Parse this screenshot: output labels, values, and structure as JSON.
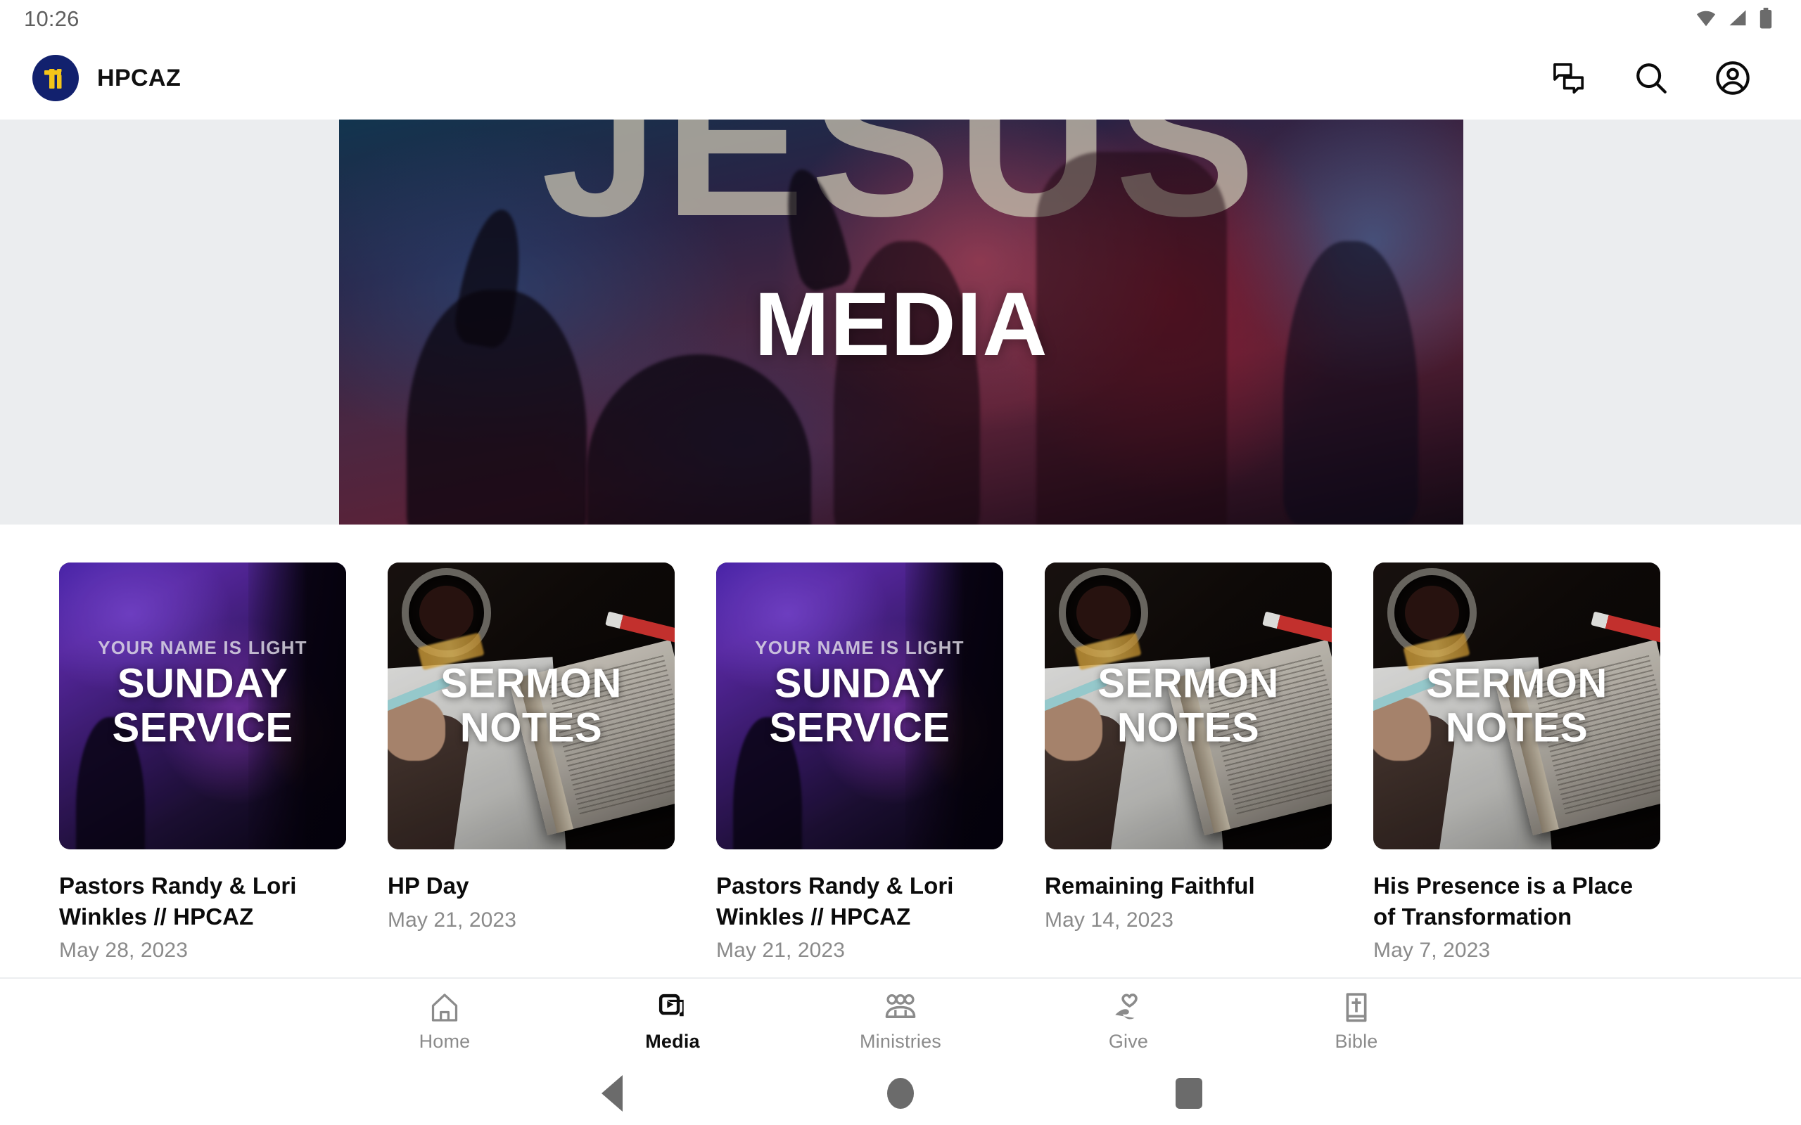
{
  "status_bar": {
    "time": "10:26",
    "icons": [
      "wifi-icon",
      "cellular-signal-icon",
      "battery-icon"
    ]
  },
  "app_bar": {
    "brand_name": "HPCAZ",
    "logo": "hpcaz-logo-icon",
    "actions": [
      {
        "name": "messages-icon",
        "label": "Messages"
      },
      {
        "name": "search-icon",
        "label": "Search"
      },
      {
        "name": "account-icon",
        "label": "Account"
      }
    ]
  },
  "hero": {
    "background_text": "JESUS",
    "title": "MEDIA",
    "side_background_color": "#ebedef"
  },
  "media_items": [
    {
      "art_style": "sunday",
      "kicker": "YOUR NAME IS LIGHT",
      "thumb_caption": "SUNDAY\nSERVICE",
      "title": "Pastors Randy & Lori Winkles // HPCAZ",
      "date": "May 28, 2023"
    },
    {
      "art_style": "notes",
      "kicker": "",
      "thumb_caption": "SERMON\nNOTES",
      "title": "HP Day",
      "date": "May 21, 2023"
    },
    {
      "art_style": "sunday",
      "kicker": "YOUR NAME IS LIGHT",
      "thumb_caption": "SUNDAY\nSERVICE",
      "title": "Pastors Randy & Lori Winkles // HPCAZ",
      "date": "May 21, 2023"
    },
    {
      "art_style": "notes",
      "kicker": "",
      "thumb_caption": "SERMON\nNOTES",
      "title": "Remaining Faithful",
      "date": "May 14, 2023"
    },
    {
      "art_style": "notes",
      "kicker": "",
      "thumb_caption": "SERMON\nNOTES",
      "title": "His Presence is a Place of Transformation",
      "date": "May 7, 2023"
    }
  ],
  "tab_bar": {
    "active": "Media",
    "tabs": [
      {
        "label": "Home",
        "icon": "home-icon",
        "active": false
      },
      {
        "label": "Media",
        "icon": "media-library-icon",
        "active": true
      },
      {
        "label": "Ministries",
        "icon": "people-group-icon",
        "active": false
      },
      {
        "label": "Give",
        "icon": "hand-heart-icon",
        "active": false
      },
      {
        "label": "Bible",
        "icon": "bible-book-icon",
        "active": false
      }
    ]
  },
  "android_nav": {
    "buttons": [
      {
        "name": "back-button",
        "icon": "triangle-back-icon"
      },
      {
        "name": "home-button",
        "icon": "circle-home-icon"
      },
      {
        "name": "recents-button",
        "icon": "square-recents-icon"
      }
    ]
  },
  "colors": {
    "brand_navy": "#12216e",
    "brand_gold": "#f5c518",
    "hero_band": "#ebedef",
    "muted_text": "#8a8a8a",
    "primary_text": "#0b0b0b"
  }
}
